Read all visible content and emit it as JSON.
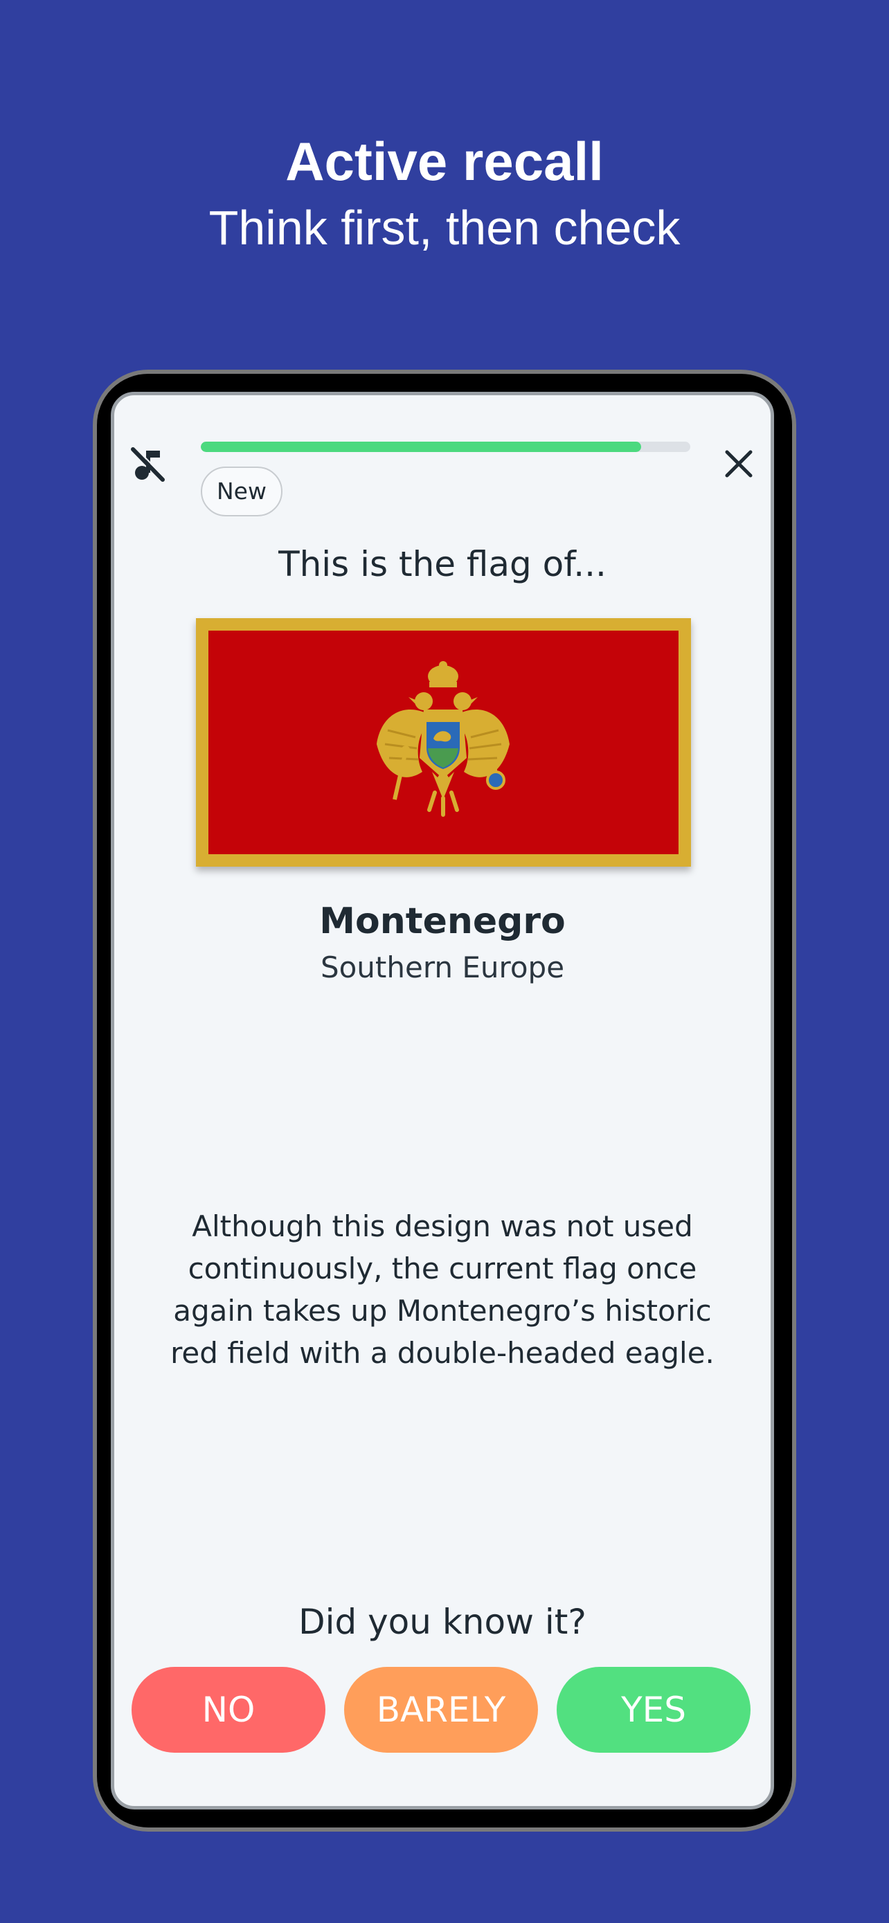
{
  "header": {
    "title": "Active recall",
    "subtitle": "Think first, then check"
  },
  "card": {
    "progress": 0.9,
    "badge": "New",
    "prompt": "This is the flag of...",
    "country": "Montenegro",
    "region": "Southern Europe",
    "fact": "Although this design was not used continuously, the current flag once again takes up Montenegro’s historic red field with a double-headed eagle.",
    "question": "Did you know it?"
  },
  "answers": {
    "no": "NO",
    "barely": "BARELY",
    "yes": "YES"
  },
  "icons": {
    "mute": "music-off-icon",
    "close": "close-icon"
  },
  "colors": {
    "background": "#303f9f",
    "progress": "#4cd97f",
    "no": "#ff6868",
    "barely": "#ff9e5a",
    "yes": "#52e080",
    "flag_red": "#c40308",
    "flag_gold": "#d8ae32"
  }
}
